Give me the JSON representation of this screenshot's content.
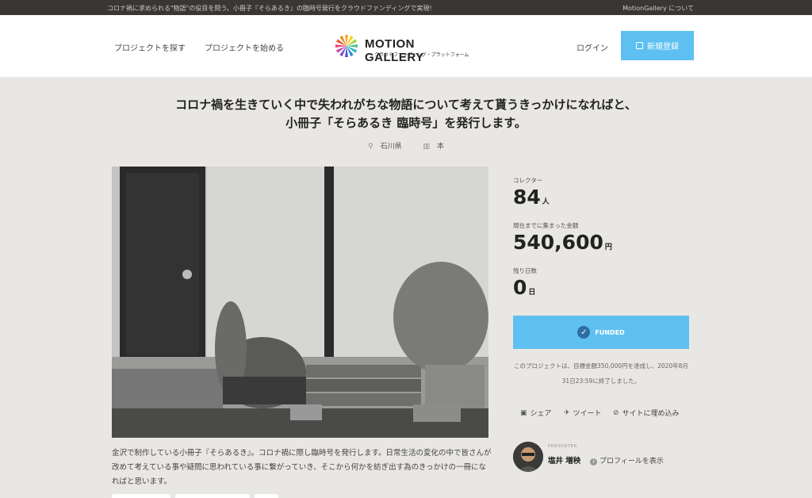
{
  "topbar": {
    "tagline": "コロナ禍に求められる\"物語\"の役目を問う。小冊子『そらあるき』の臨時号発行をクラウドファンディングで実現!",
    "about": "MotionGallery について"
  },
  "header": {
    "nav": [
      "プロジェクトを探す",
      "プロジェクトを始める"
    ],
    "logo_text": "MOTION GALLERY",
    "logo_sub": "クラウドファンディング・プラットフォーム",
    "login": "ログイン",
    "signup": "新規登録"
  },
  "project": {
    "title_line1": "コロナ禍を生きていく中で失われがちな物語について考えて貰うきっかけになればと、",
    "title_line2": "小冊子「そらあるき 臨時号」を発行します。",
    "location": "石川県",
    "category": "本",
    "description": "金沢で制作している小冊子『そらあるき』。コロナ禍に際し臨時号を発行します。日常生活の変化の中で皆さんが改めて考えている事や疑問に思われている事に繋がっていき、そこから何かを紡ぎ出す為のきっかけの一冊になればと思います。"
  },
  "stats": {
    "collectors_label": "コレクター",
    "collectors_value": "84",
    "collectors_unit": "人",
    "amount_label": "現在までに集まった金額",
    "amount_value": "540,600",
    "amount_unit": "円",
    "days_label": "残り日数",
    "days_value": "0",
    "days_unit": "日"
  },
  "funded": {
    "label": "FUNDED",
    "note": "このプロジェクトは、目標金額350,000円を達成し、2020年8月31日23:59に終了しました。"
  },
  "share": {
    "share_label": "シェア",
    "tweet_label": "ツイート",
    "embed_label": "サイトに埋め込み"
  },
  "presenter": {
    "label": "PRESENTER",
    "name": "塩井 増秧",
    "profile_label": "プロフィールを表示"
  },
  "icons": [
    "map-pin-icon",
    "book-icon",
    "check-icon",
    "facebook-icon",
    "twitter-icon",
    "link-icon",
    "info-icon"
  ],
  "colors": {
    "accent": "#5ec0f0",
    "topbar": "#3a3633",
    "background": "#e9e7e3"
  }
}
